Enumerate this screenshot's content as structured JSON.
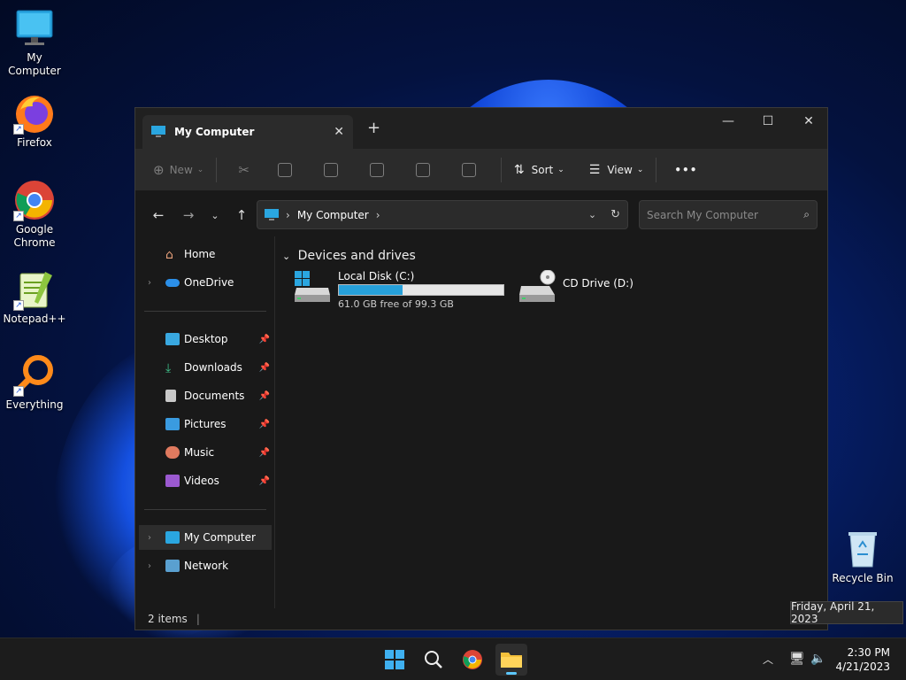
{
  "desktop": {
    "icons": [
      {
        "label": "My Computer"
      },
      {
        "label": "Firefox"
      },
      {
        "label": "Google Chrome"
      },
      {
        "label": "Notepad++"
      },
      {
        "label": "Everything"
      },
      {
        "label": "Recycle Bin"
      }
    ]
  },
  "window": {
    "tab_title": "My Computer",
    "toolbar": {
      "new_label": "New",
      "sort_label": "Sort",
      "view_label": "View",
      "more_label": "•••"
    },
    "address": {
      "path": "My Computer"
    },
    "search": {
      "placeholder": "Search My Computer"
    },
    "sidebar": {
      "items": [
        {
          "label": "Home"
        },
        {
          "label": "OneDrive"
        },
        {
          "label": "Desktop"
        },
        {
          "label": "Downloads"
        },
        {
          "label": "Documents"
        },
        {
          "label": "Pictures"
        },
        {
          "label": "Music"
        },
        {
          "label": "Videos"
        },
        {
          "label": "My Computer"
        },
        {
          "label": "Network"
        }
      ]
    },
    "content": {
      "group_title": "Devices and drives",
      "drives": [
        {
          "name": "Local Disk (C:)",
          "free_text": "61.0 GB free of 99.3 GB",
          "used_fraction": 0.386
        },
        {
          "name": "CD Drive (D:)"
        }
      ]
    },
    "status": {
      "item_count": "2 items"
    }
  },
  "tooltip": "Friday, April 21, 2023",
  "clock": {
    "time": "2:30 PM",
    "date": "4/21/2023"
  },
  "colors": {
    "accent": "#26a0da",
    "window_bg": "#191919",
    "toolbar_bg": "#2b2b2b"
  }
}
